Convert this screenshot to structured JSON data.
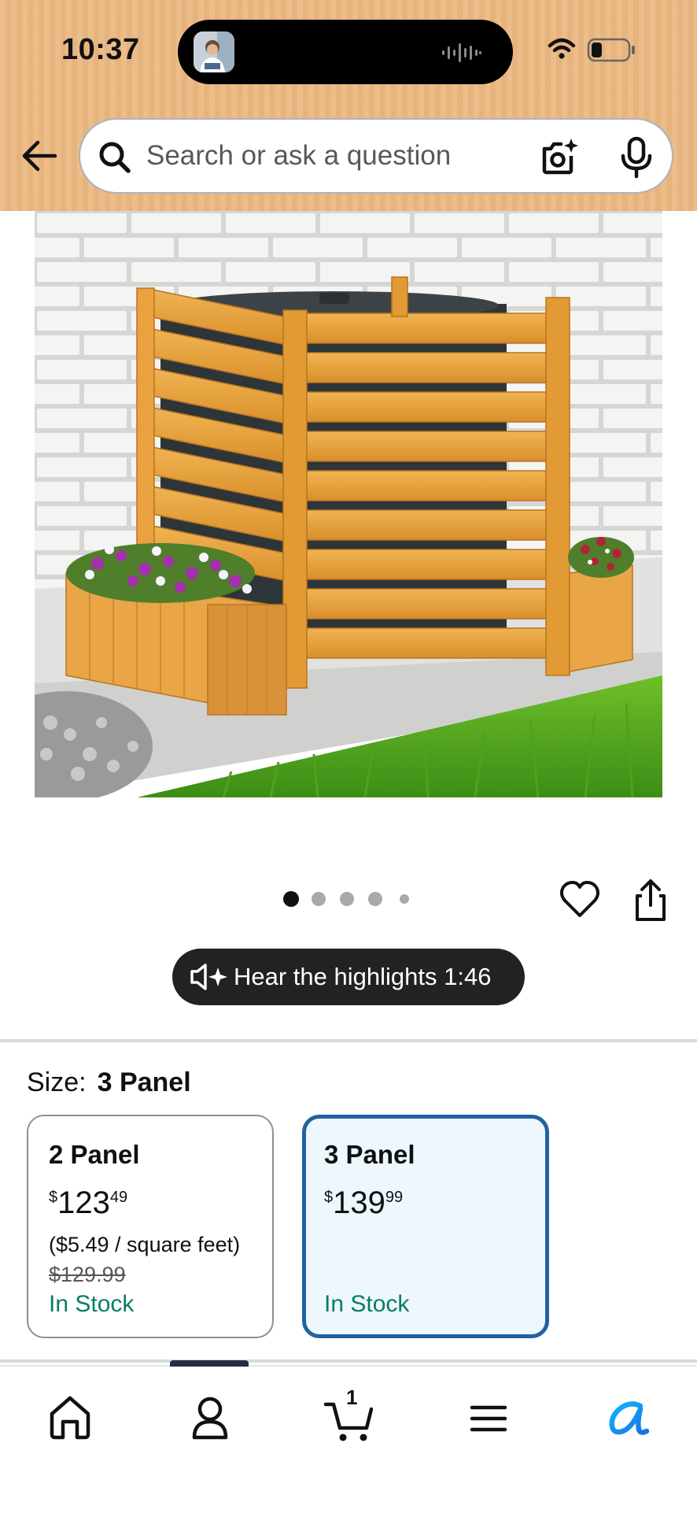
{
  "status_bar": {
    "time": "10:37"
  },
  "header": {
    "search": {
      "placeholder": "Search or ask a question"
    },
    "icons": [
      "back-arrow-icon",
      "search-icon",
      "camera-lens-icon",
      "microphone-icon"
    ]
  },
  "product_image": {
    "description_icon": "product-photo-ac-fence-planter"
  },
  "carousel": {
    "image_count": 5,
    "active_index": 0
  },
  "audio": {
    "label": "Hear the highlights 1:46"
  },
  "size_selector": {
    "label": "Size:",
    "selected": "3 Panel",
    "options": [
      {
        "name": "2 Panel",
        "price_symbol": "$",
        "price_whole": "123",
        "price_fraction": "49",
        "unit_price": "($5.49 / square feet)",
        "list_price": "$129.99",
        "stock": "In Stock",
        "selected": false
      },
      {
        "name": "3 Panel",
        "price_symbol": "$",
        "price_whole": "139",
        "price_fraction": "99",
        "stock": "In Stock",
        "selected": true
      }
    ]
  },
  "bottom_nav": {
    "items": [
      "home",
      "account",
      "cart",
      "menu",
      "rufus"
    ],
    "cart_count": "1"
  },
  "colors": {
    "header_bg": "#ebb780",
    "selected_border": "#2162a1",
    "selected_bg": "#edf7fd",
    "in_stock": "#067d62",
    "rufus_accent": "#1a98ff"
  }
}
